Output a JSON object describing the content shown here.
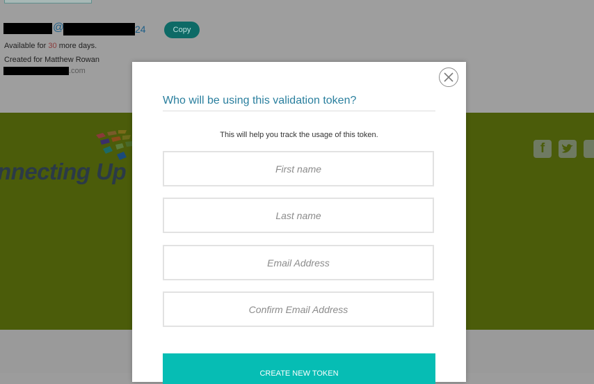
{
  "token": {
    "email_at": "@",
    "email_tail": "24",
    "copy_label": "Copy",
    "available_prefix": "Available for",
    "available_days": "30",
    "available_suffix": "more days.",
    "created_for": "Created for Matthew Rowan",
    "created_email_tail": ".com"
  },
  "footer": {
    "brand_text": "nnecting Up",
    "social_icons": [
      "facebook-icon",
      "twitter-icon",
      "youtube-icon"
    ]
  },
  "modal": {
    "title": "Who will be using this validation token?",
    "helper": "This will help you track the usage of this token.",
    "fields": {
      "first_name": "First name",
      "last_name": "Last name",
      "email": "Email Address",
      "confirm_email": "Confirm Email Address"
    },
    "submit_label": "CREATE NEW TOKEN"
  },
  "colors": {
    "accent": "#06bdb4",
    "title": "#2a7f9e",
    "footer_green": "#4b5c0a"
  }
}
